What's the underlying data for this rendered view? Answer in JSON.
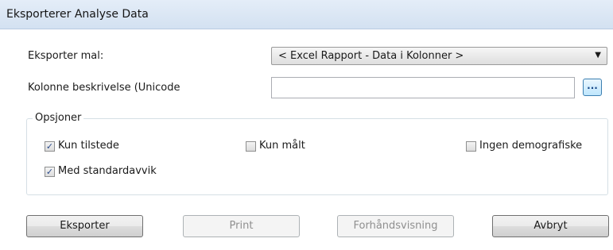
{
  "window": {
    "title": "Eksporterer Analyse Data"
  },
  "form": {
    "template_label": "Eksporter mal:",
    "template_value": "< Excel Rapport - Data i Kolonner >",
    "column_label": "Kolonne beskrivelse (Unicode",
    "column_value": "",
    "browse_label": "..."
  },
  "options": {
    "legend": "Opsjoner",
    "items": [
      {
        "label": "Kun tilstede",
        "checked": true,
        "mark": "✓"
      },
      {
        "label": "Kun målt",
        "checked": false,
        "mark": ""
      },
      {
        "label": "Ingen demografiske",
        "checked": false,
        "mark": ""
      },
      {
        "label": "Med standardavvik",
        "checked": true,
        "mark": "✓"
      }
    ]
  },
  "buttons": {
    "export": "Eksporter",
    "print": "Print",
    "preview": "Forhåndsvisning",
    "cancel": "Avbryt"
  },
  "icons": {
    "dropdown": "chevron-down-icon",
    "check": "checkmark-icon"
  }
}
